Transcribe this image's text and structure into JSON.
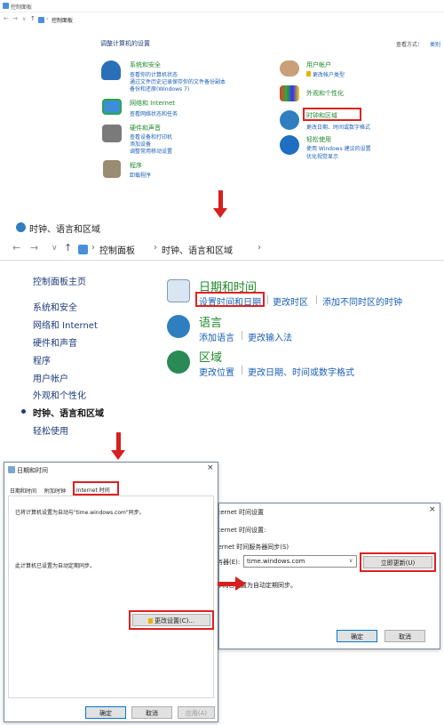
{
  "panel1": {
    "title": "控制面板",
    "breadcrumb": "控制面板",
    "heading": "调整计算机的设置",
    "view_by": "查看方式：",
    "view_cat": "类别",
    "categories": [
      {
        "title": "系统和安全",
        "links": [
          "查看你的计算机状态",
          "通过文件历史记录保存你的文件备份副本",
          "备份和还原(Windows 7)"
        ]
      },
      {
        "title": "网络和 Internet",
        "links": [
          "查看网络状态和任务"
        ]
      },
      {
        "title": "硬件和声音",
        "links": [
          "查看设备和打印机",
          "添加设备",
          "调整常用移动设置"
        ]
      },
      {
        "title": "程序",
        "links": [
          "卸载程序"
        ]
      }
    ],
    "categories_right": [
      {
        "title": "用户帐户",
        "links": [
          "更改帐户类型"
        ]
      },
      {
        "title": "外观和个性化",
        "links": []
      },
      {
        "title": "时钟和区域",
        "links": [
          "更改日期、时间或数字格式"
        ]
      },
      {
        "title": "轻松使用",
        "links": [
          "使用 Windows 建议的设置",
          "优化视觉显示"
        ]
      }
    ]
  },
  "panel2": {
    "title": "时钟、语言和区域",
    "breadcrumb": [
      "控制面板",
      "时钟、语言和区域"
    ],
    "sidebar": [
      "控制面板主页",
      "系统和安全",
      "网络和 Internet",
      "硬件和声音",
      "程序",
      "用户帐户",
      "外观和个性化",
      "时钟、语言和区域",
      "轻松使用"
    ],
    "sections": [
      {
        "title": "日期和时间",
        "links": [
          "设置时间和日期",
          "更改时区",
          "添加不同时区的时钟"
        ]
      },
      {
        "title": "语言",
        "links": [
          "添加语言",
          "更改输入法"
        ]
      },
      {
        "title": "区域",
        "links": [
          "更改位置",
          "更改日期、时间或数字格式"
        ]
      }
    ]
  },
  "dialog1": {
    "title": "日期和时间",
    "close": "×",
    "tabs": [
      "日期和时间",
      "附加时钟",
      "Internet 时间"
    ],
    "line1": "已将计算机设置为自动与\"time.windows.com\"同步。",
    "line2": "此计算机已设置为自动定期同步。",
    "change_btn": "更改设置(C)...",
    "ok": "确定",
    "cancel": "取消",
    "apply": "应用(A)"
  },
  "dialog2": {
    "title": "Internet 时间设置",
    "close": "×",
    "sync_label": "Internet 时间设置:",
    "sync_check": "与 Internet 时间服务器同步(S)",
    "server_label": "服务器(E):",
    "server_value": "time.windows.com",
    "update_btn": "立即更新(U)",
    "status": "此计算机已设置为自动定期同步。",
    "ok": "确定",
    "cancel": "取消"
  }
}
